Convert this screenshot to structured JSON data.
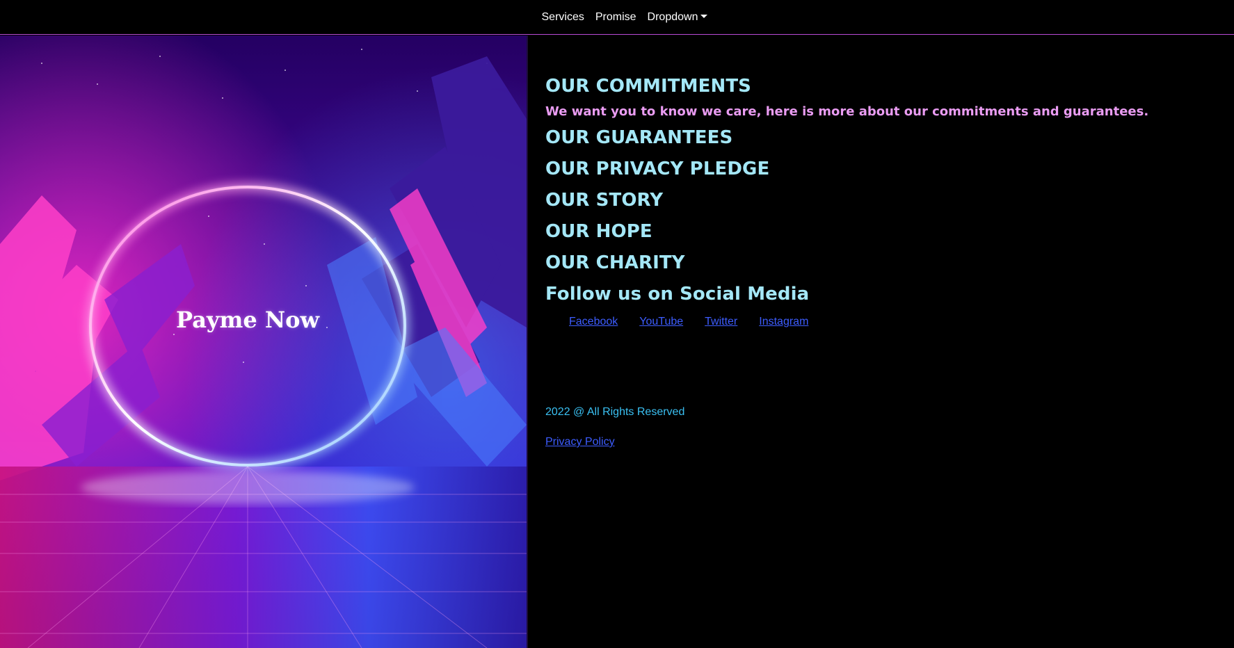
{
  "nav": {
    "items": [
      {
        "label": "Services"
      },
      {
        "label": "Promise"
      }
    ],
    "dropdown_label": "Dropdown"
  },
  "hero": {
    "title": "Payme Now"
  },
  "main": {
    "commitments_heading": "OUR COMMITMENTS",
    "commitments_subtitle": "We want you to know we care, here is more about our commitments and guarantees.",
    "guarantees_heading": "OUR GUARANTEES",
    "privacy_heading": "OUR PRIVACY PLEDGE",
    "story_heading": "OUR STORY",
    "hope_heading": "OUR HOPE",
    "charity_heading": "OUR CHARITY",
    "social_heading": "Follow us on Social Media",
    "social_links": {
      "facebook": "Facebook",
      "youtube": "YouTube",
      "twitter": "Twitter",
      "instagram": "Instagram"
    }
  },
  "footer": {
    "copyright": "2022 @ All Rights Reserved",
    "privacy_link": "Privacy Policy"
  },
  "colors": {
    "heading": "#a4e7f7",
    "subtitle": "#ea9cf2",
    "link": "#3d5dff",
    "copyright": "#3ac0f2",
    "nav_border": "#b94bd6"
  }
}
